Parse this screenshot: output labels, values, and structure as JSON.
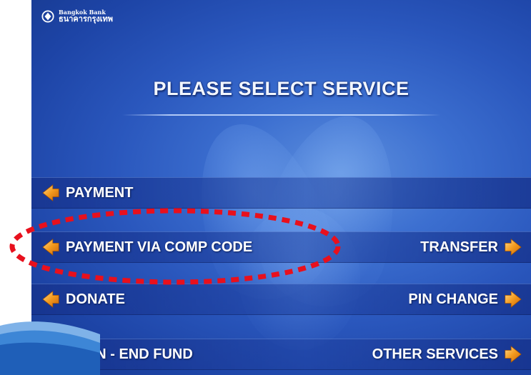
{
  "bank": {
    "name_en": "Bangkok Bank",
    "name_th": "ธนาคารกรุงเทพ"
  },
  "screen": {
    "title": "PLEASE SELECT SERVICE"
  },
  "options": {
    "payment": "PAYMENT",
    "payment_via_comp_code": "PAYMENT VIA COMP CODE",
    "transfer": "TRANSFER",
    "donate": "DONATE",
    "pin_change": "PIN CHANGE",
    "open_end_fund": "OPEN - END FUND",
    "other_services": "OTHER SERVICES"
  },
  "colors": {
    "screen_blue": "#2a57bd",
    "arrow_orange": "#f39a1e",
    "highlight_red": "#e8101d"
  },
  "icons": {
    "logo": "bangkok-bank-logo",
    "option_arrow": "orange-diamond-arrow"
  }
}
